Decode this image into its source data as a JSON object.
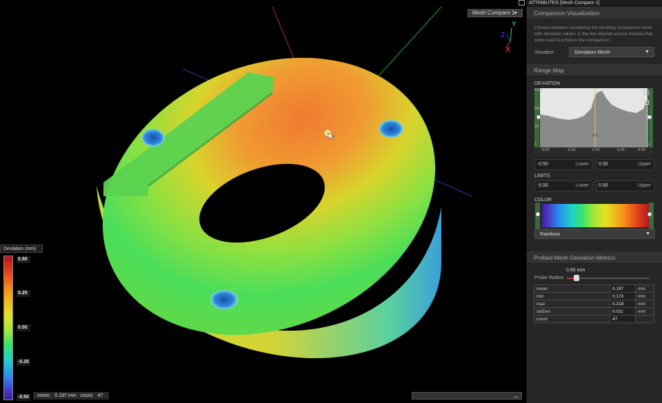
{
  "viewport": {
    "mesh_select": "Mesh Compare 1",
    "axes": {
      "y": "Y",
      "z": "Z",
      "x": "X"
    },
    "legend": {
      "title": "Deviation (mm)",
      "ticks": [
        "0.50",
        "0.25",
        "0.00",
        "-0.25",
        "-0.50"
      ]
    },
    "stats": {
      "mean_label": "mean:",
      "mean_value": "0.197 mm",
      "count_label": "count:",
      "count_value": "47"
    }
  },
  "panel": {
    "header_title": "ATTRIBUTES [Mesh Compare 1]",
    "comparison": {
      "title": "Comparison Visualization",
      "description": "Choose between visualizing the resulting comparison mesh with deviation values or the two aligned source meshes that were used to produce the comparison.",
      "visualize_label": "Visualize",
      "visualize_value": "Deviation Mesh"
    },
    "range_map": {
      "title": "Range Map",
      "deviation_label": "DEVIATION",
      "hist_y_labels": [
        "6327",
        "342",
        "18",
        "1"
      ],
      "hist_x_labels": [
        "-0.50",
        "-0.25",
        "0.00",
        "0.25",
        "0.50"
      ],
      "hist_unit": "mm",
      "hist_marker": "0.0",
      "lower_value": "-0.50",
      "lower_label": "Lower",
      "upper_value": "0.50",
      "upper_label": "Upper",
      "limits_label": "LIMITS",
      "limit_lower_value": "-0.50",
      "limit_lower_label": "Lower",
      "limit_upper_value": "0.50",
      "limit_upper_label": "Upper",
      "color_label": "COLOR",
      "colormap": "Rainbow"
    },
    "probe": {
      "title": "Probed Mesh Deviation Metrics",
      "radius_label": "Probe Radius",
      "radius_value": "0.65 mm",
      "radius_fraction": 0.12,
      "metrics": [
        {
          "name": "mean",
          "value": "0.197",
          "unit": "mm"
        },
        {
          "name": "min",
          "value": "0.170",
          "unit": "mm"
        },
        {
          "name": "max",
          "value": "0.218",
          "unit": "mm"
        },
        {
          "name": "stdDev",
          "value": "0.011",
          "unit": "mm"
        },
        {
          "name": "count",
          "value": "47",
          "unit": ""
        }
      ]
    }
  },
  "colors": {
    "accent_red": "#c33333",
    "panel_bg": "#262626",
    "rail_green": "#3b6a3b"
  }
}
